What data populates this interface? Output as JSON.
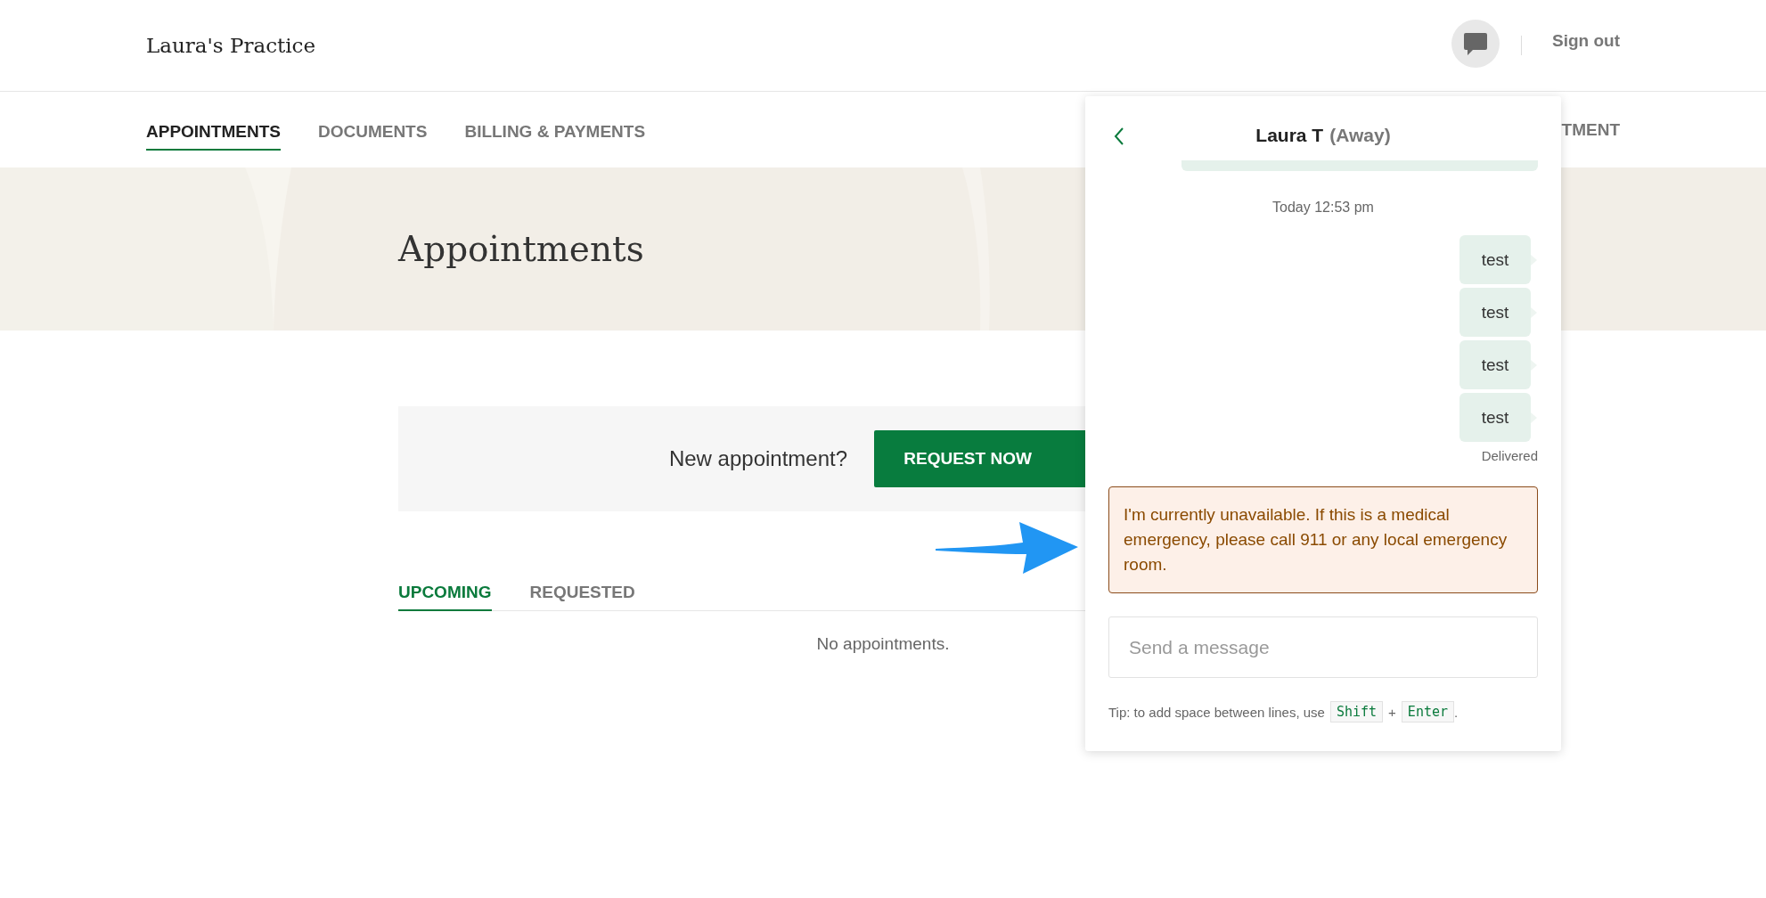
{
  "header": {
    "logo": "Laura's Practice",
    "sign_out": "Sign out"
  },
  "nav": {
    "tabs": [
      {
        "label": "APPOINTMENTS",
        "selected": true
      },
      {
        "label": "DOCUMENTS",
        "selected": false
      },
      {
        "label": "BILLING & PAYMENTS",
        "selected": false
      }
    ],
    "partial_right": "TMENT"
  },
  "page": {
    "title": "Appointments",
    "new_appointment": {
      "prompt": "New appointment?",
      "button": "REQUEST NOW"
    },
    "tabs": [
      {
        "label": "UPCOMING",
        "selected": true
      },
      {
        "label": "REQUESTED",
        "selected": false
      }
    ],
    "empty_message": "No appointments."
  },
  "chat": {
    "name": "Laura T",
    "status": "(Away)",
    "timestamp": "Today 12:53 pm",
    "messages": [
      {
        "text": "test"
      },
      {
        "text": "test"
      },
      {
        "text": "test"
      },
      {
        "text": "test"
      }
    ],
    "delivery_status": "Delivered",
    "alert": "I'm currently unavailable. If this is a medical emergency, please call 911 or any local emergency room.",
    "input": {
      "placeholder": "Send a message"
    },
    "tip": {
      "text": "Tip: to add space between lines, use",
      "keys": [
        "Shift",
        "Enter"
      ],
      "separator": "+",
      "suffix": "."
    }
  }
}
